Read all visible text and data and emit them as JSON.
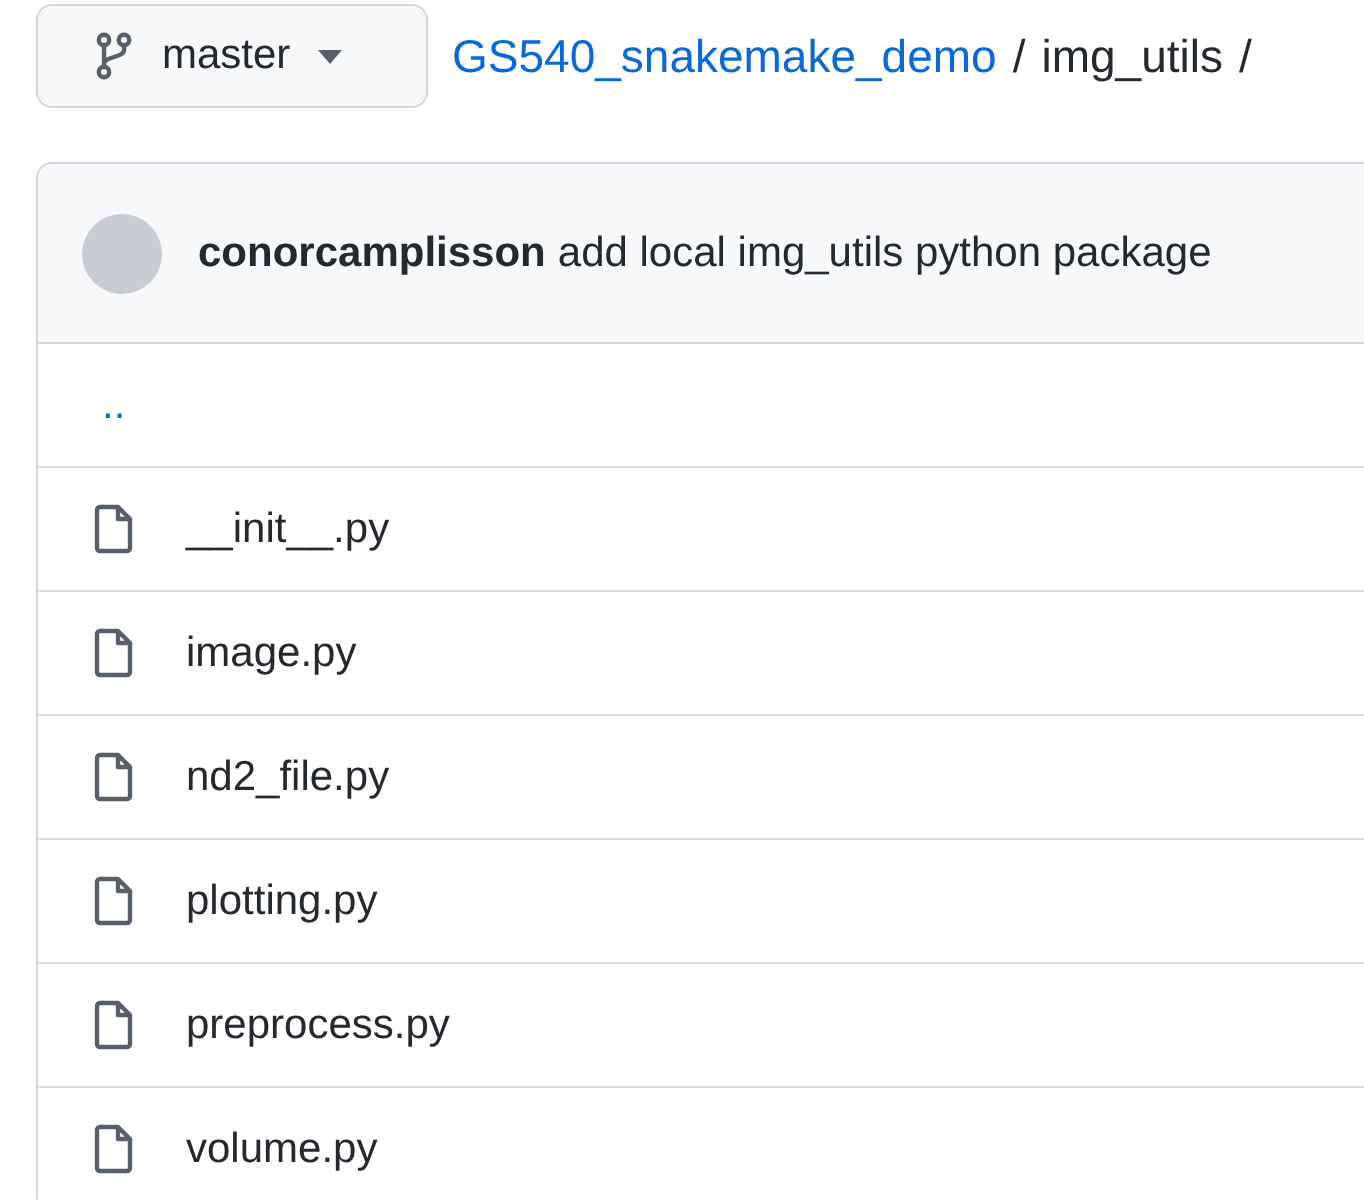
{
  "branch_button": {
    "label": "master"
  },
  "breadcrumb": [
    {
      "label": "GS540_snakemake_demo",
      "kind": "link",
      "separator": "/"
    },
    {
      "label": "img_utils",
      "kind": "current",
      "separator": "/"
    }
  ],
  "latest_commit": {
    "author": "conorcamplisson",
    "message": "add local img_utils python package"
  },
  "files": [
    {
      "name": "..",
      "kind": "parent"
    },
    {
      "name": "__init__.py",
      "kind": "file"
    },
    {
      "name": "image.py",
      "kind": "file"
    },
    {
      "name": "nd2_file.py",
      "kind": "file"
    },
    {
      "name": "plotting.py",
      "kind": "file"
    },
    {
      "name": "preprocess.py",
      "kind": "file"
    },
    {
      "name": "volume.py",
      "kind": "file"
    }
  ]
}
